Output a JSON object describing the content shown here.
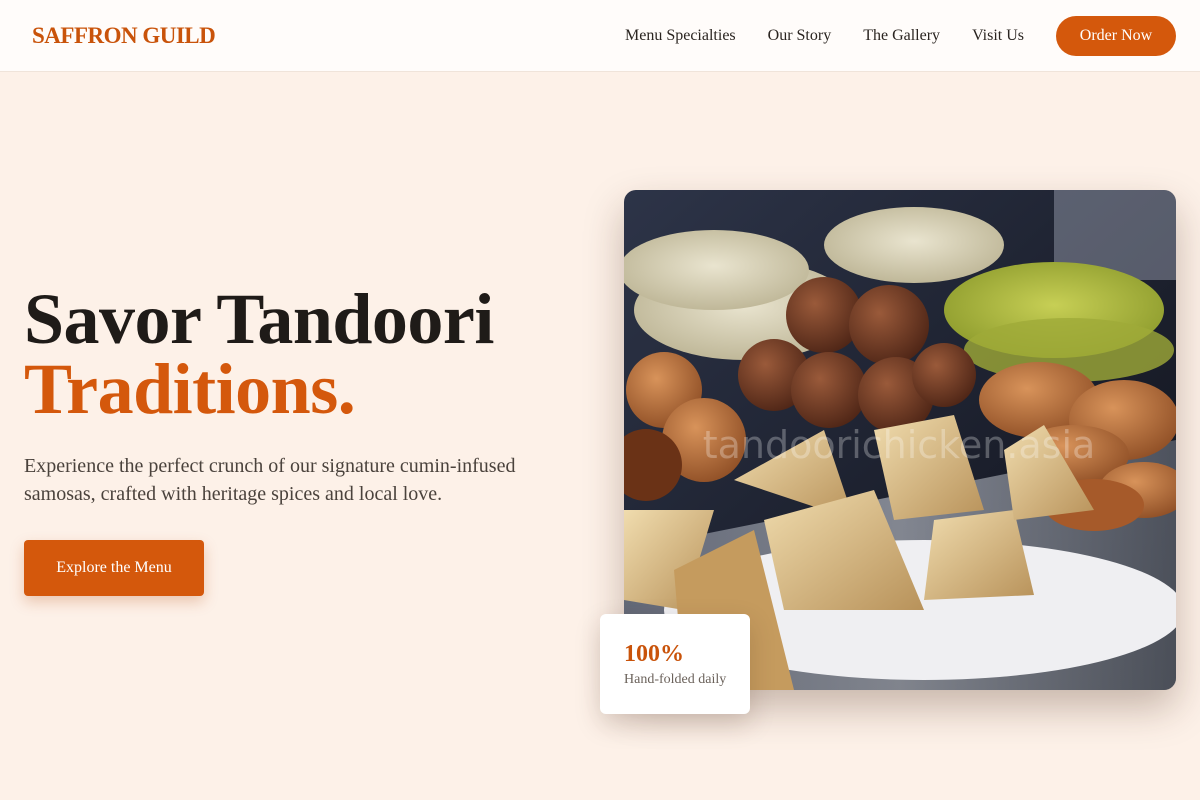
{
  "nav": {
    "brand": "SAFFRON GUILD",
    "links": [
      "Menu Specialties",
      "Our Story",
      "The Gallery",
      "Visit Us"
    ],
    "cta": "Order Now"
  },
  "hero": {
    "title_line1": "Savor Tandoori",
    "title_line2": "Traditions.",
    "description": "Experience the perfect crunch of our signature cumin-infused samosas, crafted with heritage spices and local love.",
    "button": "Explore the Menu"
  },
  "photo": {
    "alt": "A platter of samosas, kachoris and tandoori breads",
    "watermark": "tandoorichicken.asia"
  },
  "stat": {
    "value": "100%",
    "label": "Hand-folded daily"
  },
  "colors": {
    "accent": "#d4580c",
    "brand": "#c9530a",
    "background": "#fdf1e8"
  }
}
